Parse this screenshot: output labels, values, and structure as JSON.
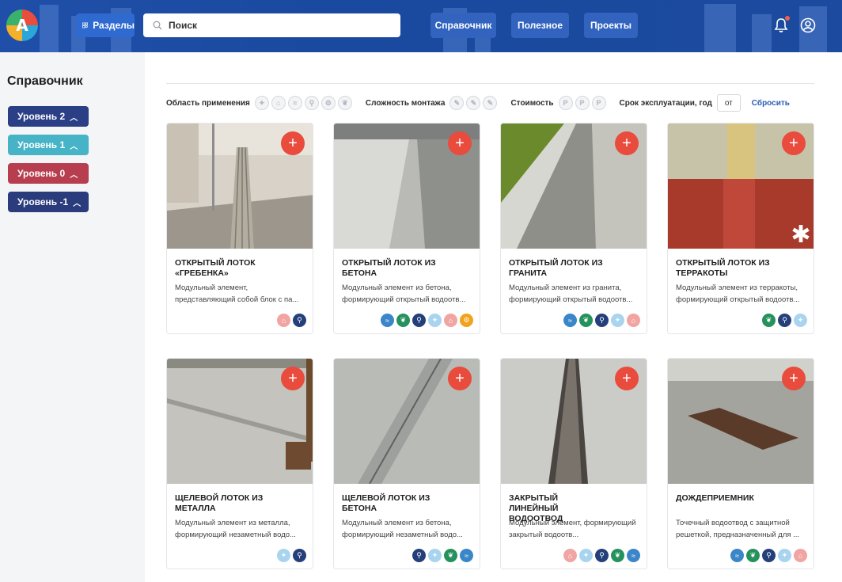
{
  "header": {
    "logo_text": "A",
    "sections_label": "Разделы",
    "search_placeholder": "Поиск",
    "nav": [
      "Справочник",
      "Полезное",
      "Проекты"
    ]
  },
  "sidebar": {
    "title": "Справочник",
    "levels": [
      {
        "label": "Уровень 2",
        "color": "#2a3f86"
      },
      {
        "label": "Уровень 1",
        "color": "#46b3c6"
      },
      {
        "label": "Уровень 0",
        "color": "#b73e4f"
      },
      {
        "label": "Уровень -1",
        "color": "#2b3c7c"
      }
    ]
  },
  "filters": {
    "area_label": "Область применения",
    "complexity_label": "Сложность монтажа",
    "cost_label": "Стоимость",
    "cost_symbol": "Р",
    "lifetime_label": "Срок эксплуатации, год",
    "lifetime_placeholder": "от",
    "reset_label": "Сбросить"
  },
  "cards": [
    {
      "title": "Открытый лоток «гребенка»",
      "desc": "Модульный элемент, представляющий собой блок с па...",
      "icons": [
        "basket-icon",
        "pedestrian-icon"
      ]
    },
    {
      "title": "Открытый лоток из бетона",
      "desc": "Модульный элемент из бетона, формирующий открытый водоотв...",
      "icons": [
        "water-icon",
        "leaf-icon",
        "pedestrian-icon",
        "tree-icon",
        "basket-icon",
        "playground-icon"
      ]
    },
    {
      "title": "Открытый лоток из гранита",
      "desc": "Модульный элемент из гранита, формирующий открытый водоотв...",
      "icons": [
        "water-icon",
        "leaf-icon",
        "pedestrian-icon",
        "tree-icon",
        "basket-icon"
      ]
    },
    {
      "title": "Открытый лоток из терракоты",
      "desc": "Модульный элемент из терракоты, формирующий открытый водоотв...",
      "icons": [
        "leaf-icon",
        "pedestrian-icon",
        "tree-icon"
      ]
    },
    {
      "title": "Щелевой лоток из металла",
      "desc": "Модульный элемент из металла, формирующий незаметный водо...",
      "icons": [
        "tree-icon",
        "pedestrian-icon"
      ]
    },
    {
      "title": "Щелевой лоток из бетона",
      "desc": "Модульный элемент из бетона, формирующий незаметный водо...",
      "icons": [
        "pedestrian-icon",
        "tree-icon",
        "leaf-icon",
        "water-icon"
      ]
    },
    {
      "title": "Закрытый линейный водоотвод",
      "desc": "Модульный элемент, формирующий закрытый водоотв...",
      "icons": [
        "basket-icon",
        "tree-icon",
        "pedestrian-icon",
        "leaf-icon",
        "water-icon"
      ]
    },
    {
      "title": "Дождеприемник",
      "desc": "Точечный водоотвод с защитной решеткой, предназначенный для ...",
      "icons": [
        "water-icon",
        "leaf-icon",
        "pedestrian-icon",
        "tree-icon",
        "basket-icon"
      ]
    }
  ],
  "icon_colors": {
    "water-icon": "#3a86c8",
    "leaf-icon": "#25915c",
    "pedestrian-icon": "#243f7a",
    "tree-icon": "#a9d4ef",
    "basket-icon": "#f1a5a2",
    "playground-icon": "#f1a31c"
  }
}
